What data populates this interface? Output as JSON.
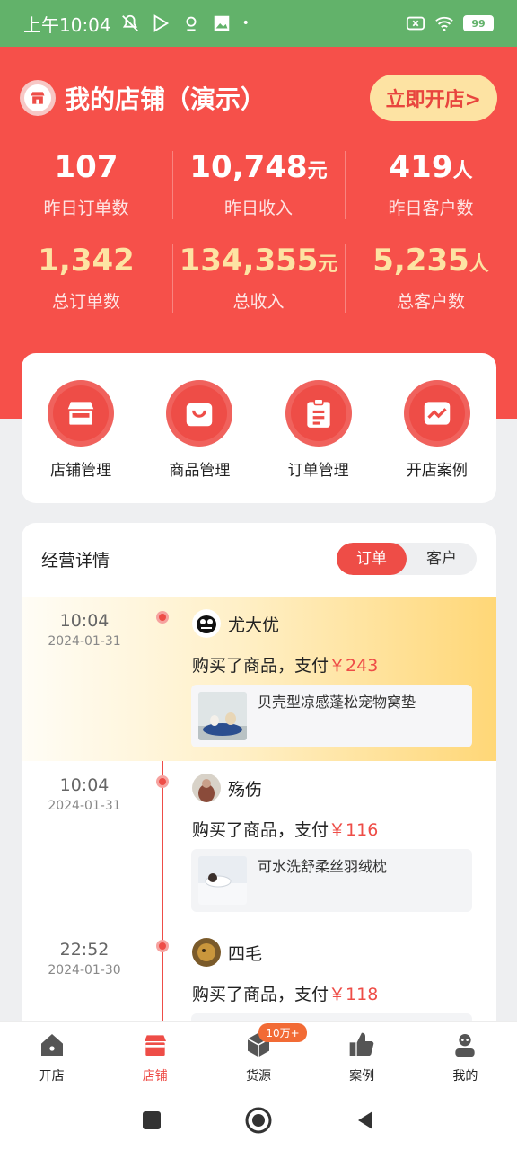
{
  "status_bar": {
    "time": "上午10:04",
    "battery": "99"
  },
  "header": {
    "shop_name": "我的店铺（演示）",
    "open_shop_button": "立即开店>"
  },
  "stats": {
    "yesterday": [
      {
        "value": "107",
        "unit": "",
        "label": "昨日订单数"
      },
      {
        "value": "10,748",
        "unit": "元",
        "label": "昨日收入"
      },
      {
        "value": "419",
        "unit": "人",
        "label": "昨日客户数"
      }
    ],
    "total": [
      {
        "value": "1,342",
        "unit": "",
        "label": "总订单数"
      },
      {
        "value": "134,355",
        "unit": "元",
        "label": "总收入"
      },
      {
        "value": "5,235",
        "unit": "人",
        "label": "总客户数"
      }
    ]
  },
  "quick_menu": [
    {
      "label": "店铺管理",
      "icon": "store-icon"
    },
    {
      "label": "商品管理",
      "icon": "shopping-bag-icon"
    },
    {
      "label": "订单管理",
      "icon": "clipboard-icon"
    },
    {
      "label": "开店案例",
      "icon": "chart-icon"
    }
  ],
  "details": {
    "title": "经营详情",
    "tabs": [
      "订单",
      "客户"
    ],
    "active_tab": "订单",
    "entries": [
      {
        "time": "10:04",
        "date": "2024-01-31",
        "user": "尤大优",
        "action": "购买了商品，支付",
        "price": "￥243",
        "product": "贝壳型凉感蓬松宠物窝垫"
      },
      {
        "time": "10:04",
        "date": "2024-01-31",
        "user": "殇伤",
        "action": "购买了商品，支付",
        "price": "￥116",
        "product": "可水洗舒柔丝羽绒枕"
      },
      {
        "time": "22:52",
        "date": "2024-01-30",
        "user": "四毛",
        "action": "购买了商品，支付",
        "price": "￥118",
        "product": ""
      }
    ]
  },
  "bottom_nav": {
    "items": [
      {
        "label": "开店",
        "icon": "house-icon"
      },
      {
        "label": "店铺",
        "icon": "store-icon"
      },
      {
        "label": "货源",
        "icon": "box-icon",
        "badge": "10万+"
      },
      {
        "label": "案例",
        "icon": "thumbs-up-icon"
      },
      {
        "label": "我的",
        "icon": "user-icon"
      }
    ],
    "active": "店铺"
  },
  "colors": {
    "primary": "#ee4d47",
    "hero": "#f6504a",
    "gold": "#fde3a3",
    "status_bar": "#62b26a"
  }
}
